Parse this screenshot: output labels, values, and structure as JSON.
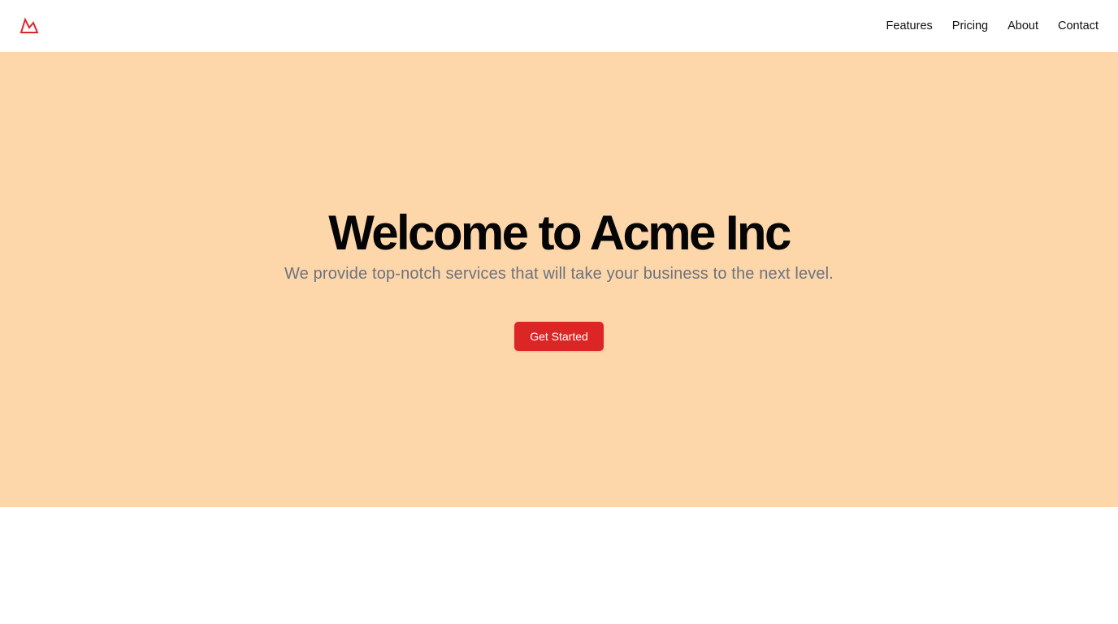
{
  "brand": {
    "logo_icon": "mountain-icon",
    "logo_color": "#dc2626"
  },
  "nav": {
    "items": [
      {
        "label": "Features"
      },
      {
        "label": "Pricing"
      },
      {
        "label": "About"
      },
      {
        "label": "Contact"
      }
    ]
  },
  "hero": {
    "background": "#fdd7aa",
    "title": "Welcome to Acme Inc",
    "subtitle": "We provide top-notch services that will take your business to the next level.",
    "cta_label": "Get Started",
    "cta_color": "#dc2626"
  }
}
